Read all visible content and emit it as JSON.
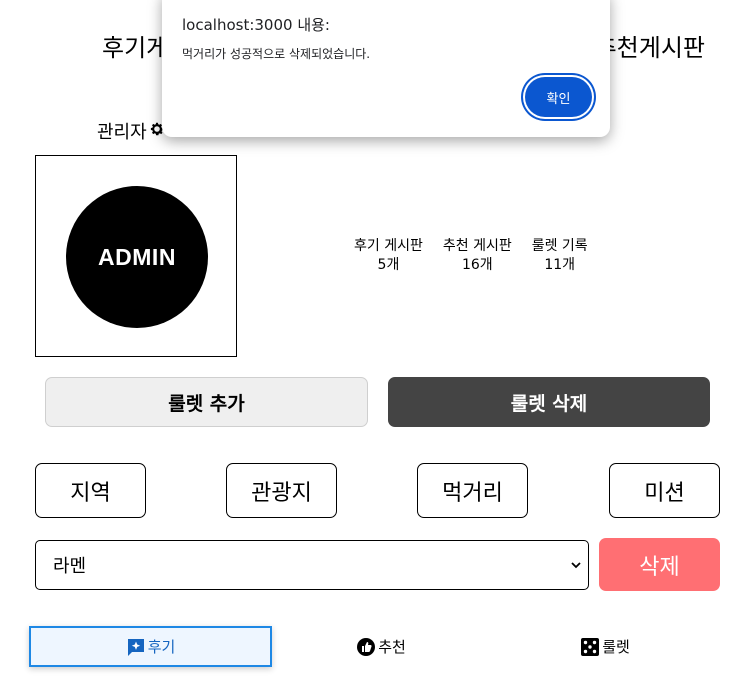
{
  "top_nav": {
    "left_label": "후기게",
    "right_label": "추천게시판"
  },
  "admin": {
    "label": "관리자",
    "avatar_text": "ADMIN"
  },
  "stats": [
    {
      "label": "후기 게시판",
      "value": "5개"
    },
    {
      "label": "추천 게시판",
      "value": "16개"
    },
    {
      "label": "룰렛 기록",
      "value": "11개"
    }
  ],
  "actions": {
    "add_label": "룰렛 추가",
    "delete_label": "룰렛 삭제"
  },
  "categories": [
    "지역",
    "관광지",
    "먹거리",
    "미션"
  ],
  "select": {
    "value": "라멘"
  },
  "delete_button": "삭제",
  "tabs": [
    {
      "label": "후기",
      "icon": "chat-sparkle-icon"
    },
    {
      "label": "추천",
      "icon": "thumb-up-icon"
    },
    {
      "label": "룰렛",
      "icon": "dice-icon"
    }
  ],
  "dialog": {
    "title": "localhost:3000 내용:",
    "message": "먹거리가 성공적으로 삭제되었습니다.",
    "ok_label": "확인"
  },
  "colors": {
    "delete_accent": "#ff6f73",
    "dark_button": "#444444",
    "tab_active_border": "#1e88e5",
    "dialog_button": "#0b57d0"
  }
}
